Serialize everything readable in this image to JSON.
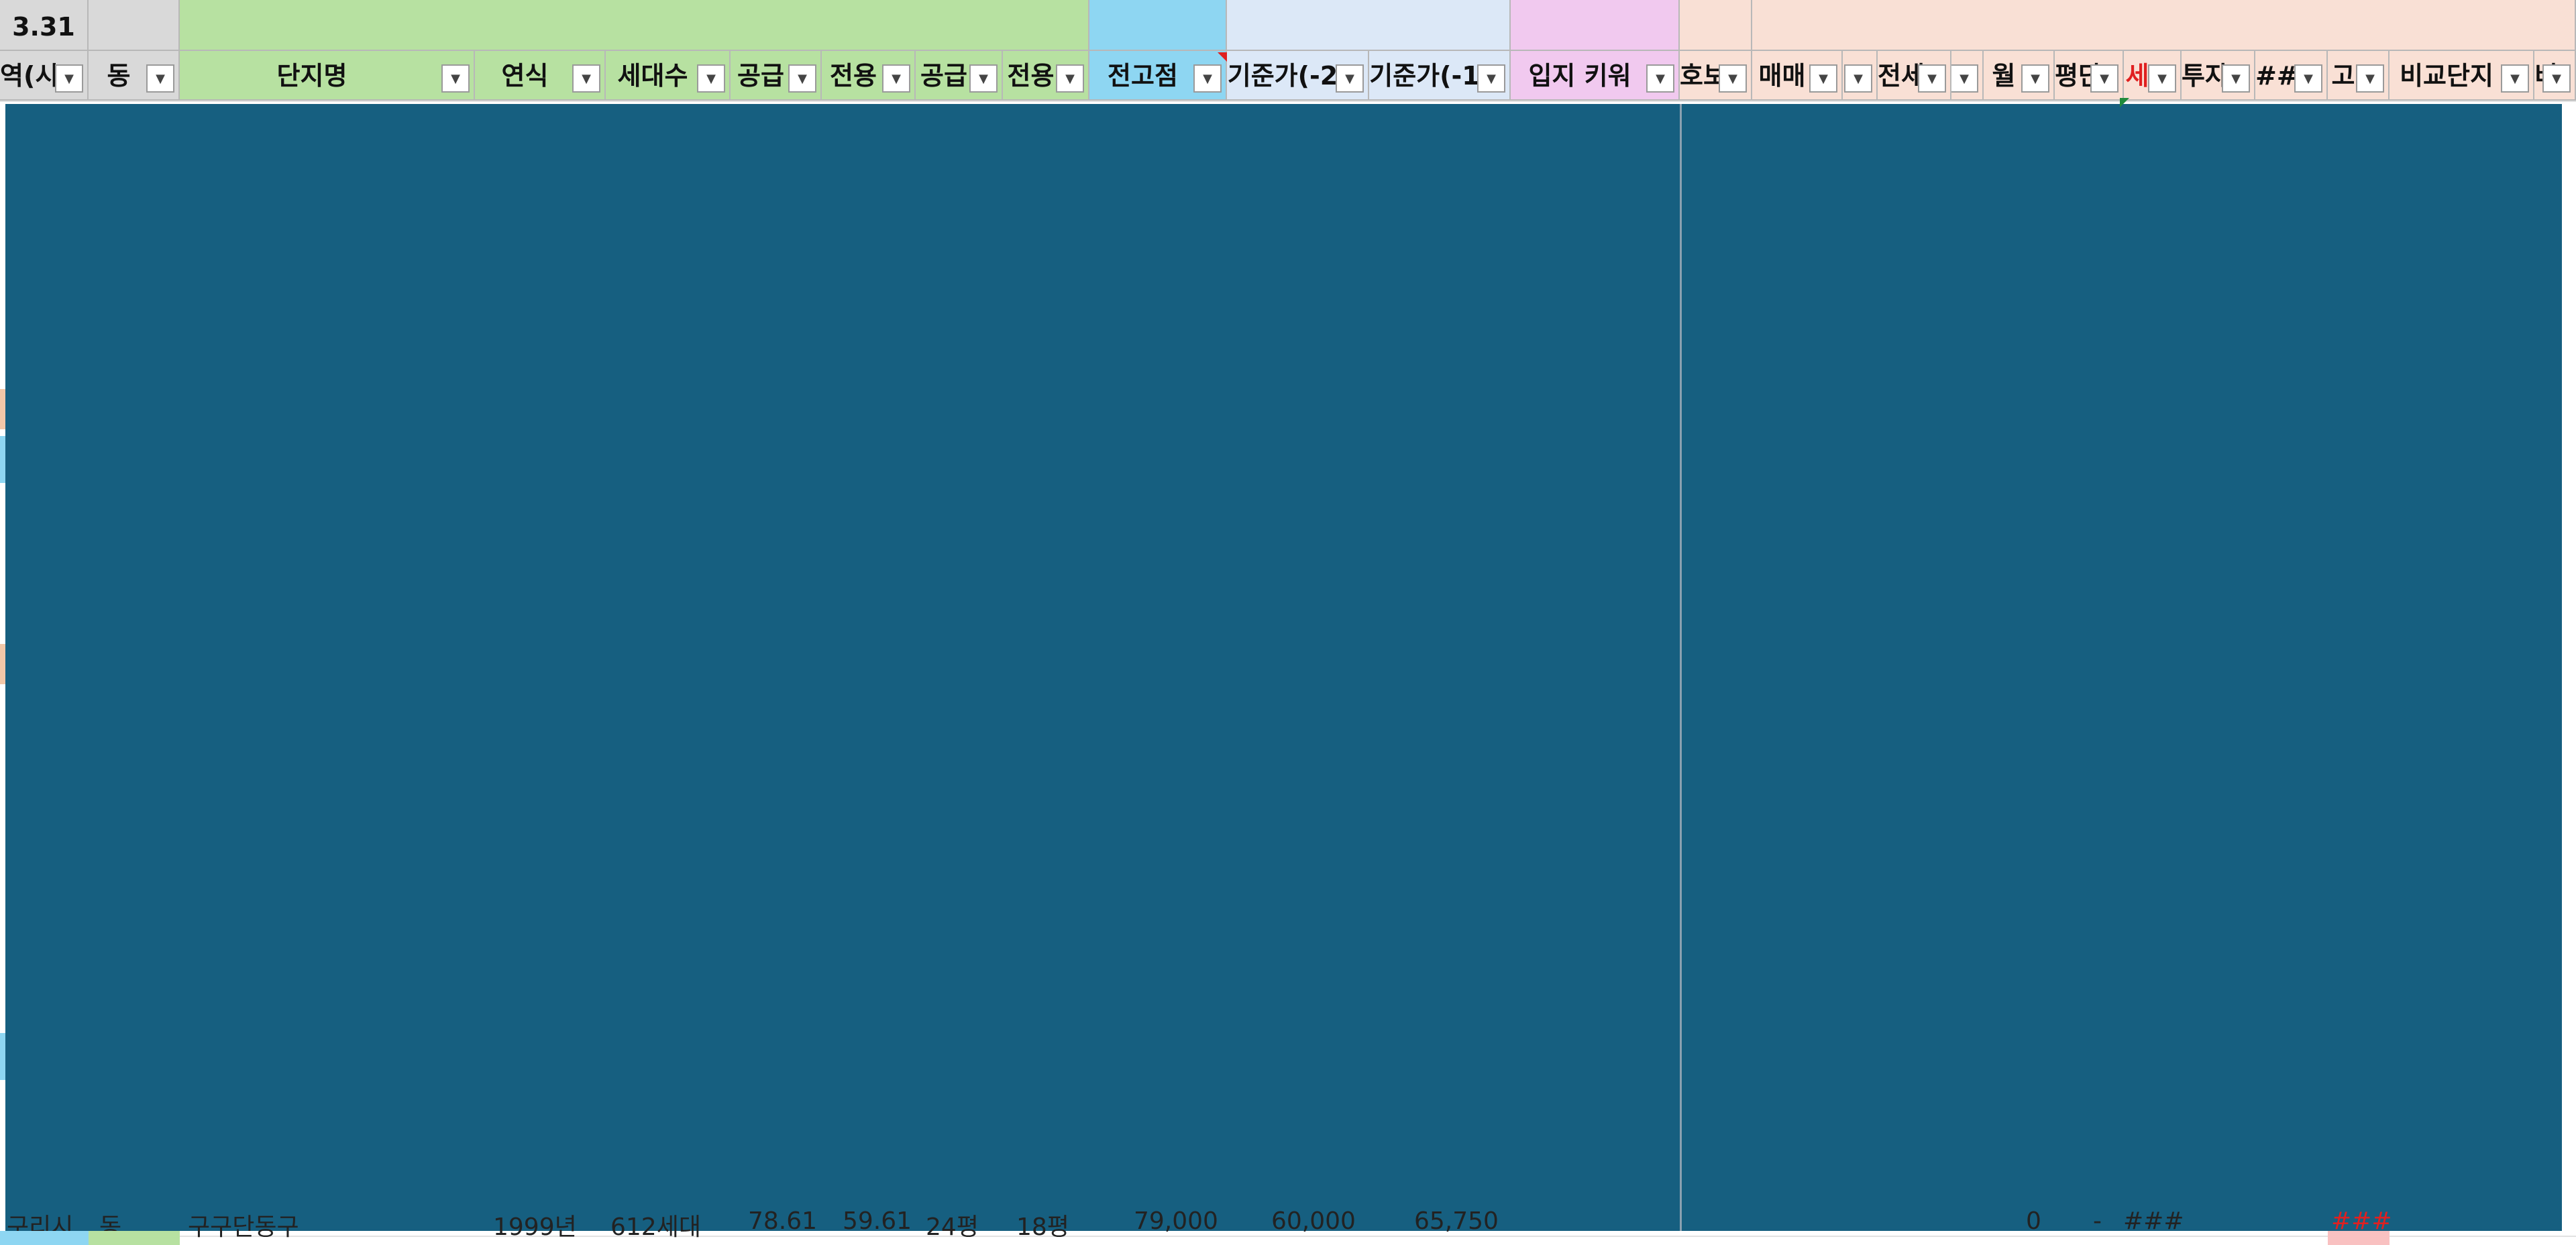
{
  "sheet": {
    "top_cell": "3.31",
    "columns": [
      {
        "label": "역(시",
        "bg": "#d9d9d9"
      },
      {
        "label": "동",
        "bg": "#d9d9d9"
      },
      {
        "label": "단지명",
        "bg": "#b7e1a1"
      },
      {
        "label": "연식",
        "bg": "#b7e1a1"
      },
      {
        "label": "세대수",
        "bg": "#b7e1a1"
      },
      {
        "label": "공급",
        "bg": "#b7e1a1"
      },
      {
        "label": "전용",
        "bg": "#b7e1a1"
      },
      {
        "label": "공급",
        "bg": "#b7e1a1"
      },
      {
        "label": "전용",
        "bg": "#b7e1a1"
      },
      {
        "label": "전고점",
        "bg": "#8ed6f2"
      },
      {
        "label": "기준가(-2",
        "bg": "#dce8f7"
      },
      {
        "label": "기준가(-1",
        "bg": "#dce8f7"
      },
      {
        "label": "입지 키워",
        "bg": "#f1c9ef"
      },
      {
        "label": "호보",
        "bg": "#f9e0d5"
      },
      {
        "label": "매매",
        "bg": "#f9e0d5"
      },
      {
        "label": "",
        "bg": "#f9e0d5"
      },
      {
        "label": "전세",
        "bg": "#f9e0d5"
      },
      {
        "label": "",
        "bg": "#f9e0d5"
      },
      {
        "label": "월",
        "bg": "#f9e0d5"
      },
      {
        "label": "평단",
        "bg": "#f9e0d5"
      },
      {
        "label": "세",
        "bg": "#f9e0d5",
        "red": true
      },
      {
        "label": "투자",
        "bg": "#f9e0d5"
      },
      {
        "label": "##",
        "bg": "#f9e0d5"
      },
      {
        "label": "고",
        "bg": "#f9e0d5"
      },
      {
        "label": "비교단지",
        "bg": "#f9e0d5"
      },
      {
        "label": "비",
        "bg": "#f9e0d5"
      }
    ],
    "visible_bottom_row": {
      "region": "구리시",
      "dong": "동",
      "name": "구구단동구",
      "year": "1999년",
      "households": "612세대",
      "supply": "78.61",
      "exclusive": "59.61",
      "supply_py": "24평",
      "exclusive_py": "18평",
      "peak": "79,000",
      "base2": "60,000",
      "base1": "65,750",
      "wol": "0",
      "pyeong": "-",
      "hash1": "###",
      "hash2": "###"
    }
  }
}
